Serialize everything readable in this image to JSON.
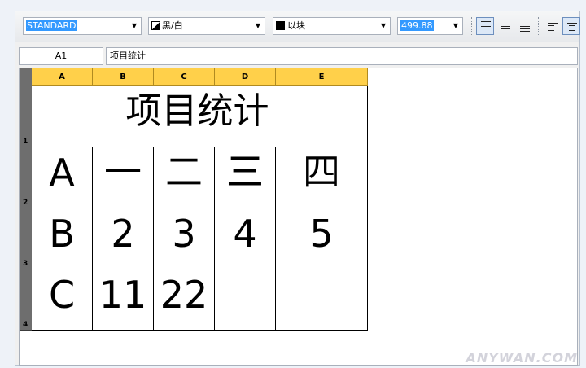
{
  "toolbar": {
    "style_value": "STANDARD",
    "color_value": "黑/白",
    "linetype_value": "以块",
    "size_value": "499.88"
  },
  "formula_bar": {
    "cell_ref": "A1",
    "content": "项目统计"
  },
  "sheet": {
    "columns": [
      "A",
      "B",
      "C",
      "D",
      "E"
    ],
    "rows": [
      "1",
      "2",
      "3",
      "4"
    ],
    "title": "项目统计",
    "cells": [
      [
        "A",
        "一",
        "二",
        "三",
        "四"
      ],
      [
        "B",
        "2",
        "3",
        "4",
        "5"
      ],
      [
        "C",
        "11",
        "22",
        "",
        ""
      ]
    ]
  },
  "watermark": "ANYWAN.COM"
}
